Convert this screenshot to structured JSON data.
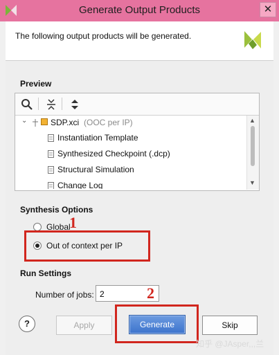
{
  "window": {
    "title": "Generate Output Products",
    "close_glyph": "✕",
    "app_icon": "vivado-app-icon"
  },
  "header": {
    "text": "The following output products will be generated."
  },
  "preview": {
    "title": "Preview",
    "toolbar": [
      "search-icon",
      "collapse-all-icon",
      "expand-all-icon"
    ],
    "tree": {
      "root": {
        "name": "SDP.xci",
        "suffix": "(OOC per IP)"
      },
      "children": [
        "Instantiation Template",
        "Synthesized Checkpoint (.dcp)",
        "Structural Simulation",
        "Change Log"
      ]
    }
  },
  "synthesis": {
    "title": "Synthesis Options",
    "options": [
      {
        "label": "Global",
        "selected": false
      },
      {
        "label": "Out of context per IP",
        "selected": true
      }
    ]
  },
  "run": {
    "title": "Run Settings",
    "jobs_label": "Number of jobs:",
    "jobs_value": "2"
  },
  "buttons": {
    "help": "?",
    "apply": "Apply",
    "generate": "Generate",
    "skip": "Skip"
  },
  "annotations": {
    "one": "1",
    "two": "2",
    "color": "#d1261e"
  },
  "watermark": "知乎 @JAsper,,,兰"
}
